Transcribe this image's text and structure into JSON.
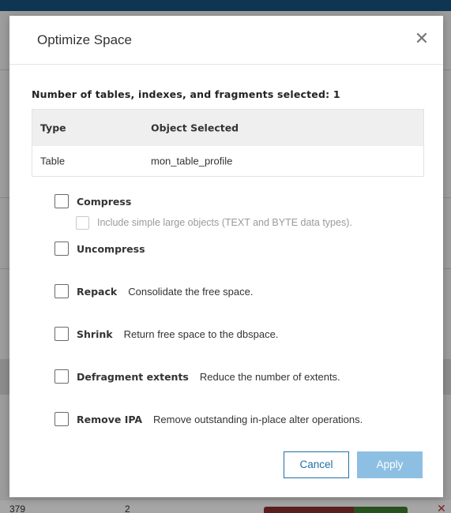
{
  "background": {
    "bottom_row": {
      "col1": "379",
      "col2": "2"
    }
  },
  "dialog": {
    "title": "Optimize Space",
    "close_icon": "close-icon",
    "summary_label": "Number of tables, indexes, and fragments selected: 1",
    "table": {
      "headers": [
        "Type",
        "Object Selected"
      ],
      "rows": [
        [
          "Table",
          "mon_table_profile"
        ]
      ]
    },
    "options": {
      "compress": {
        "label": "Compress",
        "checked": false
      },
      "include_large_objects": {
        "label": "Include simple large objects (TEXT and BYTE data types).",
        "checked": false,
        "disabled": true
      },
      "uncompress": {
        "label": "Uncompress",
        "checked": false
      },
      "repack": {
        "label": "Repack",
        "description": "Consolidate the free space.",
        "checked": false
      },
      "shrink": {
        "label": "Shrink",
        "description": "Return free space to the dbspace.",
        "checked": false
      },
      "defragment": {
        "label": "Defragment extents",
        "description": "Reduce the number of extents.",
        "checked": false
      },
      "remove_ipa": {
        "label": "Remove IPA",
        "description": "Remove outstanding in-place alter operations.",
        "checked": false
      }
    },
    "buttons": {
      "cancel": "Cancel",
      "apply": "Apply"
    },
    "colors": {
      "primary": "#1f6fa8",
      "apply_disabled": "#8dbfe3",
      "header_bar": "#0e3552"
    }
  }
}
